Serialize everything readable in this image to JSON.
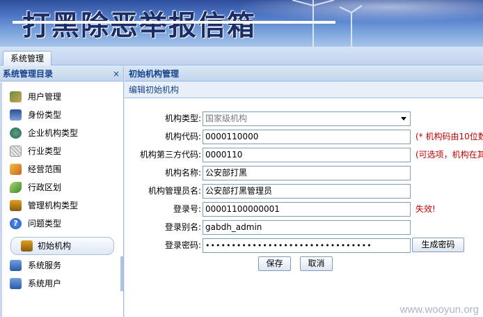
{
  "banner": {
    "title": "打黑除恶举报信箱"
  },
  "tabs": [
    {
      "label": "系统管理"
    }
  ],
  "sidebar": {
    "title": "系统管理目录",
    "close": "×",
    "items": [
      {
        "label": "用户管理",
        "icon": "users-icon"
      },
      {
        "label": "身份类型",
        "icon": "person-icon"
      },
      {
        "label": "企业机构类型",
        "icon": "globe-icon"
      },
      {
        "label": "行业类型",
        "icon": "gear-icon"
      },
      {
        "label": "经营范围",
        "icon": "pencil-icon"
      },
      {
        "label": "行政区划",
        "icon": "leaf-icon"
      },
      {
        "label": "管理机构类型",
        "icon": "network-icon"
      },
      {
        "label": "问题类型",
        "icon": "question-icon"
      },
      {
        "label": "初始机构",
        "icon": "network-icon"
      },
      {
        "label": "系统服务",
        "icon": "computer-icon"
      },
      {
        "label": "系统用户",
        "icon": "computer-user-icon"
      }
    ]
  },
  "main": {
    "title": "初始机构管理",
    "subtitle": "编辑初始机构",
    "form": {
      "org_type_label": "机构类型:",
      "org_type_value": "国家级机构",
      "org_code_label": "机构代码:",
      "org_code_value": "0000110000",
      "org_code_note": "(* 机构码由10位数",
      "third_code_label": "机构第三方代码:",
      "third_code_value": "0000110",
      "third_code_note": "(可选项，机构在其",
      "org_name_label": "机构名称:",
      "org_name_value": "公安部打黑",
      "admin_name_label": "机构管理员名:",
      "admin_name_value": "公安部打黑管理员",
      "login_no_label": "登录号:",
      "login_no_value": "00001100000001",
      "login_no_note": "失效!",
      "alias_label": "登录别名:",
      "alias_value": "gabdh_admin",
      "password_label": "登录密码:",
      "password_value": "••••••••••••••••••••••••••••••••",
      "generate_password": "生成密码",
      "save": "保存",
      "cancel": "取消"
    }
  },
  "watermark": "www.wooyun.org"
}
